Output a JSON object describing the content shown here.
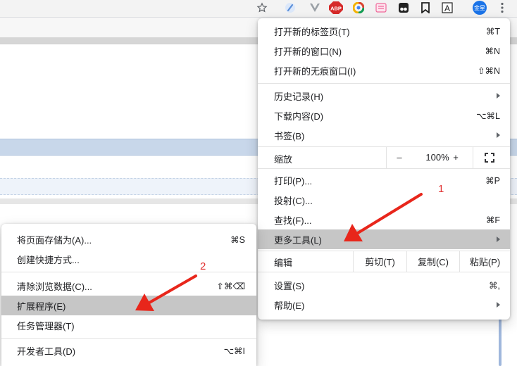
{
  "toolbar": {
    "star_icon": "star-icon",
    "extensions": [
      {
        "name": "feather-extension",
        "color": "#5b8fd9"
      },
      {
        "name": "vue-devtools-extension",
        "color": "#9aa0a6"
      },
      {
        "name": "adblock-plus-extension",
        "label": "ABP",
        "color": "#d62a2a"
      },
      {
        "name": "chrome-color-extension",
        "color": "#f4b400"
      },
      {
        "name": "pink-extension",
        "color": "#f06a9b"
      },
      {
        "name": "tampermonkey-extension",
        "color": "#222222"
      },
      {
        "name": "bookmark-extension",
        "color": "#222222"
      },
      {
        "name": "translate-extension",
        "label": "A",
        "color": "#222222"
      }
    ],
    "profile": {
      "label": "金星",
      "color": "#1a73e8"
    },
    "menu_icon": "vertical-dots-icon"
  },
  "main_menu": {
    "items": [
      {
        "label": "打开新的标签页(T)",
        "shortcut": "⌘T"
      },
      {
        "label": "打开新的窗口(N)",
        "shortcut": "⌘N"
      },
      {
        "label": "打开新的无痕窗口(I)",
        "shortcut": "⇧⌘N"
      },
      {
        "label": "历史记录(H)",
        "shortcut": ""
      },
      {
        "label": "下载内容(D)",
        "shortcut": "⌥⌘L"
      },
      {
        "label": "书签(B)",
        "shortcut": ""
      },
      {
        "label": "打印(P)...",
        "shortcut": "⌘P"
      },
      {
        "label": "投射(C)...",
        "shortcut": ""
      },
      {
        "label": "查找(F)...",
        "shortcut": "⌘F"
      },
      {
        "label": "更多工具(L)",
        "shortcut": ""
      },
      {
        "label": "设置(S)",
        "shortcut": "⌘,"
      },
      {
        "label": "帮助(E)",
        "shortcut": ""
      }
    ],
    "zoom": {
      "label": "缩放",
      "minus": "–",
      "value": "100%",
      "plus": "+"
    },
    "edit": {
      "label": "编辑",
      "cut": "剪切(T)",
      "copy": "复制(C)",
      "paste": "粘贴(P)"
    }
  },
  "sub_menu": {
    "items": [
      {
        "label": "将页面存储为(A)...",
        "shortcut": "⌘S"
      },
      {
        "label": "创建快捷方式...",
        "shortcut": ""
      },
      {
        "label": "清除浏览数据(C)...",
        "shortcut": "⇧⌘⌫"
      },
      {
        "label": "扩展程序(E)",
        "shortcut": ""
      },
      {
        "label": "任务管理器(T)",
        "shortcut": ""
      },
      {
        "label": "开发者工具(D)",
        "shortcut": "⌥⌘I"
      }
    ]
  },
  "annotations": {
    "step1": "1",
    "step2": "2",
    "arrow_color": "#e8261b"
  }
}
